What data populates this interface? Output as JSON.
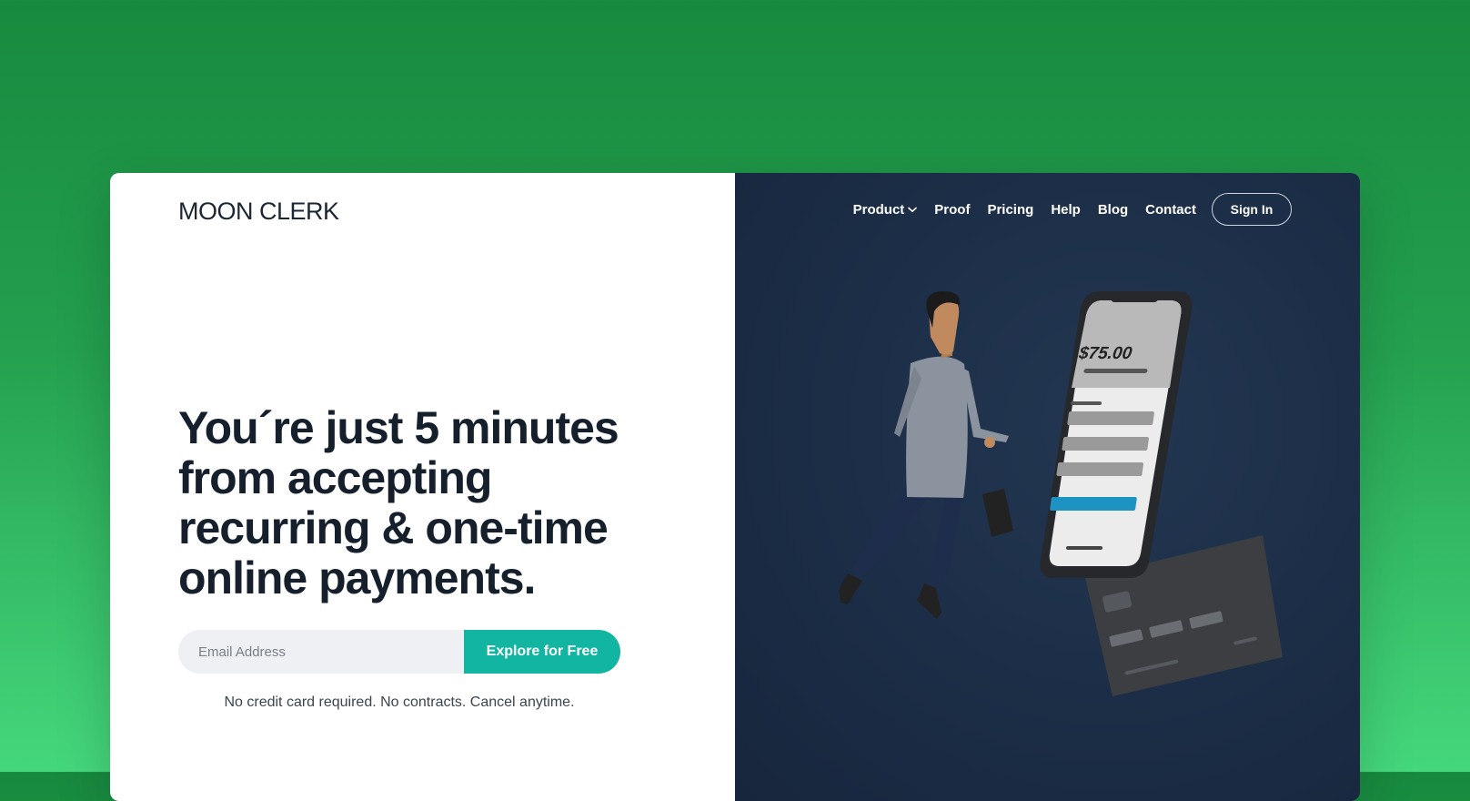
{
  "brand": {
    "logo": "MOON CLERK"
  },
  "nav": {
    "items": [
      {
        "label": "Product",
        "has_dropdown": true,
        "icon": "chevron-down-icon"
      },
      {
        "label": "Proof"
      },
      {
        "label": "Pricing"
      },
      {
        "label": "Help"
      },
      {
        "label": "Blog"
      },
      {
        "label": "Contact"
      }
    ],
    "signin_label": "Sign In"
  },
  "hero": {
    "headline_lines": [
      "You´re just 5 minutes",
      "from accepting",
      "recurring & one-time",
      "online payments."
    ],
    "email_placeholder": "Email Address",
    "email_value": "",
    "cta_label": "Explore for Free",
    "note": "No credit card required. No contracts. Cancel anytime."
  },
  "illustration": {
    "phone_amount": "$75.00"
  },
  "colors": {
    "background_top": "#188a3f",
    "background_bottom": "#45d77c",
    "panel_dark": "#1b2c45",
    "accent": "#12b5a1",
    "text_dark": "#16202c"
  }
}
